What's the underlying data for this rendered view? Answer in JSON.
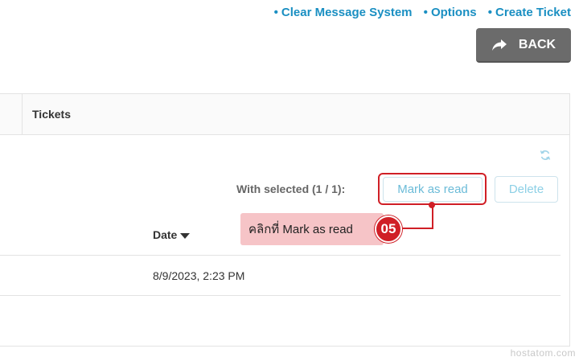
{
  "top_links": [
    {
      "bullet": "•",
      "label": "Clear Message System"
    },
    {
      "bullet": "•",
      "label": "Options"
    },
    {
      "bullet": "•",
      "label": "Create Ticket"
    }
  ],
  "back_button": {
    "label": "BACK",
    "icon": "share-arrow-icon"
  },
  "tabs": {
    "tickets": "Tickets"
  },
  "toolbar": {
    "with_selected": "With selected (1 / 1):",
    "mark_as_read": "Mark as read",
    "delete": "Delete",
    "refresh_icon": "refresh-icon"
  },
  "callout": {
    "text": "คลิกที่ Mark as read",
    "step": "05"
  },
  "table": {
    "columns": {
      "date": "Date"
    },
    "rows": [
      {
        "date": "8/9/2023, 2:23 PM"
      }
    ]
  },
  "watermark": "hostatom.com",
  "colors": {
    "link": "#1a8fc2",
    "back_bg": "#6b6b6b",
    "callout_red": "#d01f26",
    "callout_bg": "#f6c4c7",
    "button_text": "#6bbbd8"
  }
}
